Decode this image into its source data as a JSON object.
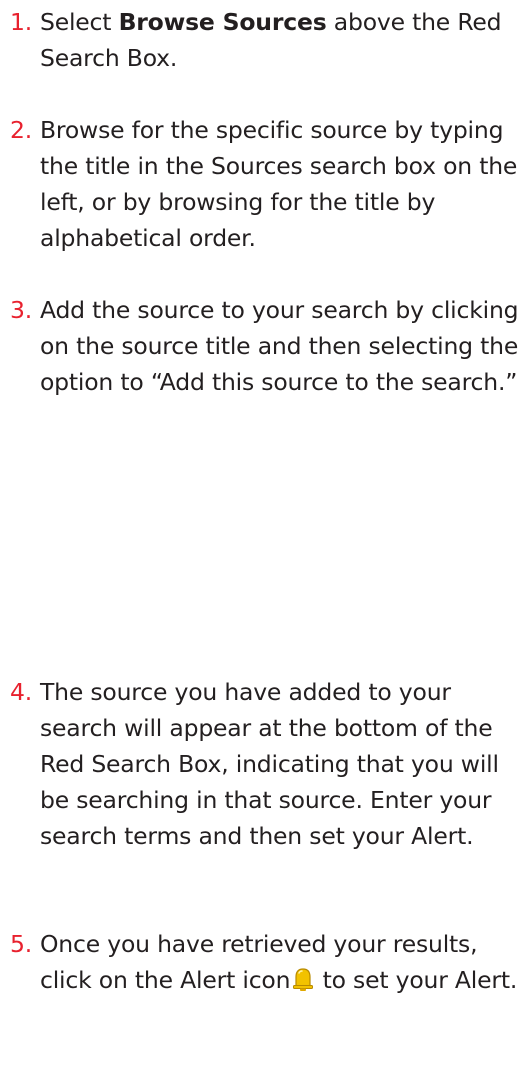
{
  "steps": [
    {
      "number": "1.",
      "text_before": "Select ",
      "bold": "Browse Sources",
      "text_after": " above the Red Search Box."
    },
    {
      "number": "2.",
      "text": "Browse for the specific source by typing the title in the Sources search box on the left, or by browsing for the title by alphabetical order."
    },
    {
      "number": "3.",
      "text": "Add the source to your search by clicking on the source title and then selecting the option to “Add this source to the search.”"
    },
    {
      "number": "4.",
      "text": "The source you have added to your search will appear at the bottom of the Red Search Box, indicating that you will be searching in that source. Enter your search terms and then set your Alert."
    },
    {
      "number": "5.",
      "text_before": "Once you have retrieved your results, click on the Alert icon",
      "icon": "alert-bell-icon",
      "text_after": " to set your Alert."
    }
  ],
  "colors": {
    "step_number": "#e8212e",
    "body_text": "#231f20",
    "icon_bell": "#f2c200"
  }
}
